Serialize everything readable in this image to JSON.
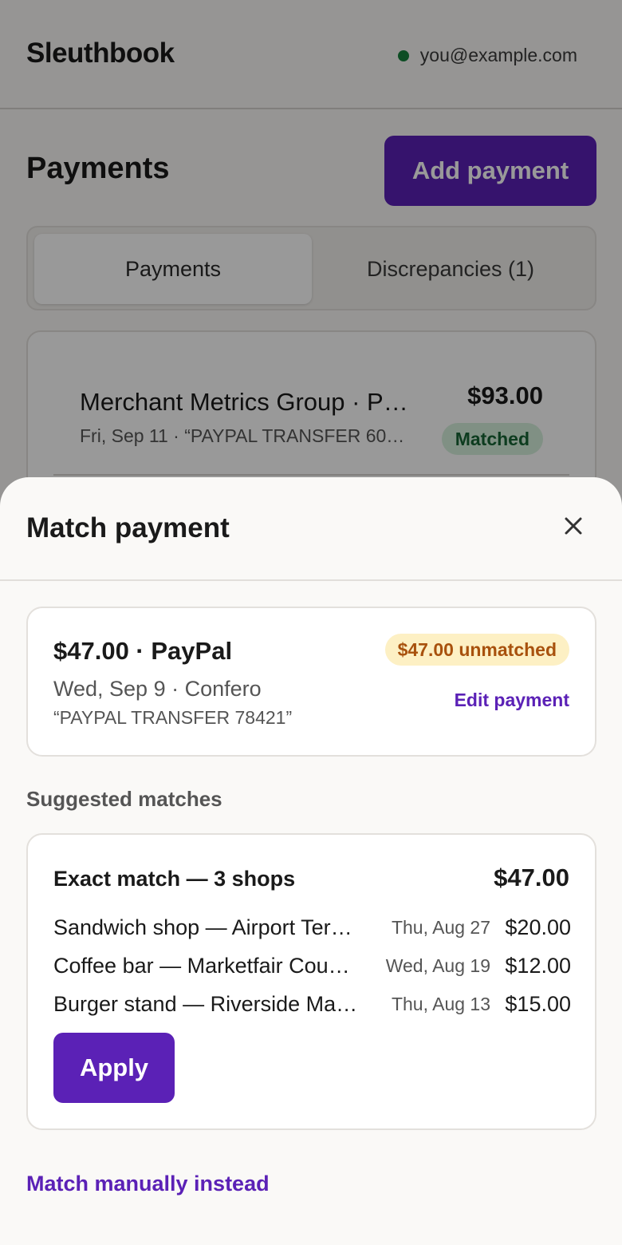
{
  "app": {
    "brand": "Sleuthbook",
    "user_email": "you@example.com",
    "user_status_color": "#16803c"
  },
  "payments_page": {
    "title": "Payments",
    "add_button": "Add payment",
    "tabs": [
      {
        "label": "Payments",
        "active": true
      },
      {
        "label": "Discrepancies (1)",
        "active": false
      }
    ],
    "rows": [
      {
        "title": "Merchant Metrics Group · P…",
        "subtitle": "Fri, Sep 11 · “PAYPAL TRANSFER 60…",
        "amount": "$93.00",
        "status": "Matched"
      }
    ]
  },
  "sheet": {
    "title": "Match payment",
    "close_icon": "close-icon",
    "payment": {
      "headline": "$47.00 · PayPal",
      "date_payer": "Wed, Sep 9 · Confero",
      "memo": "“PAYPAL TRANSFER 78421”",
      "unmatched_badge": "$47.00 unmatched",
      "edit_link": "Edit payment"
    },
    "suggested_label": "Suggested matches",
    "match": {
      "title": "Exact match — 3 shops",
      "total": "$47.00",
      "items": [
        {
          "name": "Sandwich shop — Airport Ter…",
          "date": "Thu, Aug 27",
          "amount": "$20.00"
        },
        {
          "name": "Coffee bar — Marketfair Cou…",
          "date": "Wed, Aug 19",
          "amount": "$12.00"
        },
        {
          "name": "Burger stand — Riverside Ma…",
          "date": "Thu, Aug 13",
          "amount": "$15.00"
        }
      ],
      "apply_label": "Apply"
    },
    "manual_link": "Match manually instead"
  },
  "colors": {
    "accent": "#5b21b6",
    "matched_bg": "#d6f0dd",
    "matched_text": "#166534",
    "unmatched_bg": "#fdf0c4",
    "unmatched_text": "#a8510d"
  }
}
